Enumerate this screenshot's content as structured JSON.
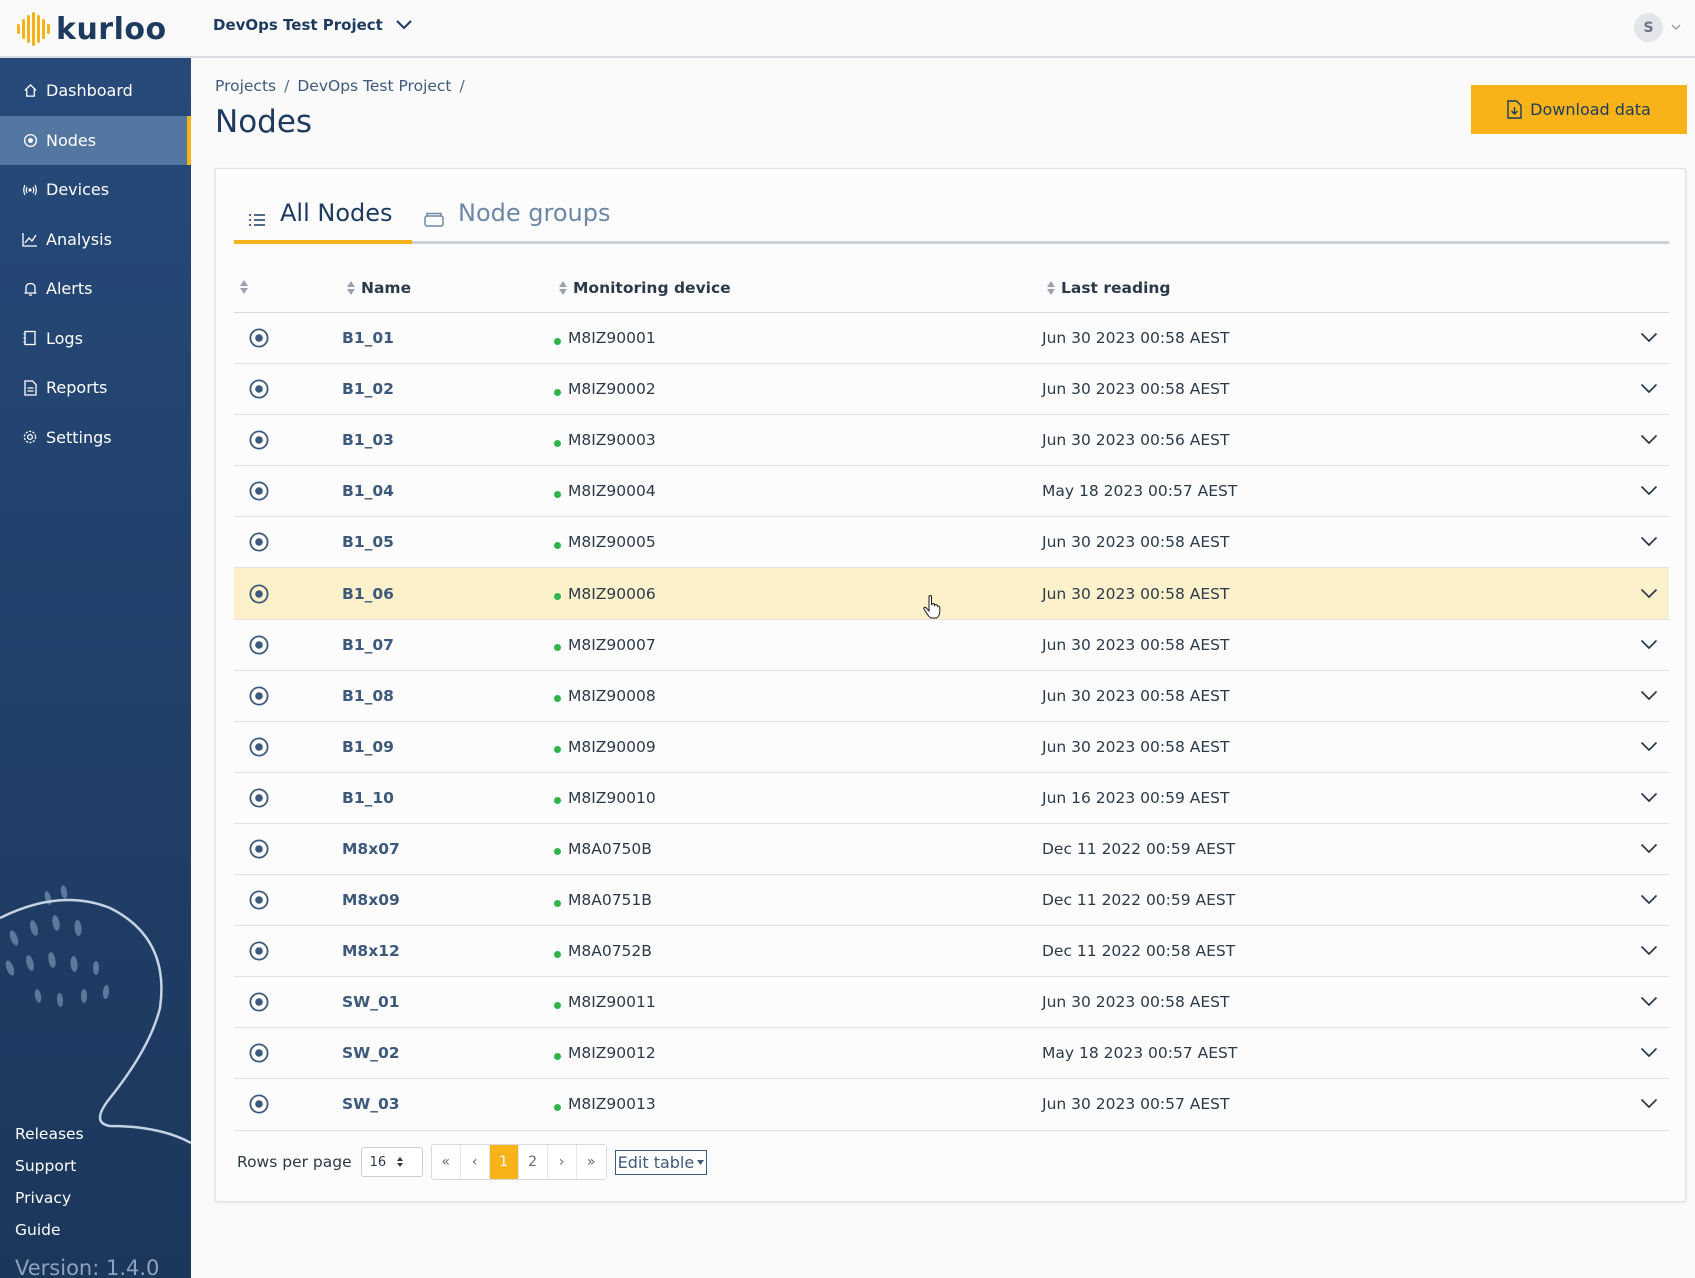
{
  "brand": {
    "name": "kurloo"
  },
  "header": {
    "project": "DevOps Test Project",
    "user_initial": "S"
  },
  "sidebar": {
    "items": [
      {
        "label": "Dashboard",
        "icon": "home-icon"
      },
      {
        "label": "Nodes",
        "icon": "node-icon",
        "active": true
      },
      {
        "label": "Devices",
        "icon": "signal-icon"
      },
      {
        "label": "Analysis",
        "icon": "chart-icon"
      },
      {
        "label": "Alerts",
        "icon": "bell-icon"
      },
      {
        "label": "Logs",
        "icon": "log-icon"
      },
      {
        "label": "Reports",
        "icon": "report-icon"
      },
      {
        "label": "Settings",
        "icon": "gear-icon"
      }
    ],
    "footer_links": [
      "Releases",
      "Support",
      "Privacy",
      "Guide"
    ],
    "version": "Version: 1.4.0"
  },
  "breadcrumb": [
    "Projects",
    "DevOps Test Project"
  ],
  "page": {
    "title": "Nodes",
    "download_label": "Download data"
  },
  "tabs": [
    {
      "label": "All Nodes",
      "icon": "list-icon",
      "active": true
    },
    {
      "label": "Node groups",
      "icon": "folder-icon",
      "active": false
    }
  ],
  "table": {
    "columns": [
      "Name",
      "Monitoring device",
      "Last reading"
    ],
    "rows": [
      {
        "name": "B1_01",
        "device": "M8IZ90001",
        "reading": "Jun 30 2023 00:58 AEST"
      },
      {
        "name": "B1_02",
        "device": "M8IZ90002",
        "reading": "Jun 30 2023 00:58 AEST"
      },
      {
        "name": "B1_03",
        "device": "M8IZ90003",
        "reading": "Jun 30 2023 00:56 AEST"
      },
      {
        "name": "B1_04",
        "device": "M8IZ90004",
        "reading": "May 18 2023 00:57 AEST"
      },
      {
        "name": "B1_05",
        "device": "M8IZ90005",
        "reading": "Jun 30 2023 00:58 AEST"
      },
      {
        "name": "B1_06",
        "device": "M8IZ90006",
        "reading": "Jun 30 2023 00:58 AEST",
        "highlighted": true
      },
      {
        "name": "B1_07",
        "device": "M8IZ90007",
        "reading": "Jun 30 2023 00:58 AEST"
      },
      {
        "name": "B1_08",
        "device": "M8IZ90008",
        "reading": "Jun 30 2023 00:58 AEST"
      },
      {
        "name": "B1_09",
        "device": "M8IZ90009",
        "reading": "Jun 30 2023 00:58 AEST"
      },
      {
        "name": "B1_10",
        "device": "M8IZ90010",
        "reading": "Jun 16 2023 00:59 AEST"
      },
      {
        "name": "M8x07",
        "device": "M8A0750B",
        "reading": "Dec 11 2022 00:59 AEST"
      },
      {
        "name": "M8x09",
        "device": "M8A0751B",
        "reading": "Dec 11 2022 00:59 AEST"
      },
      {
        "name": "M8x12",
        "device": "M8A0752B",
        "reading": "Dec 11 2022 00:58 AEST"
      },
      {
        "name": "SW_01",
        "device": "M8IZ90011",
        "reading": "Jun 30 2023 00:58 AEST"
      },
      {
        "name": "SW_02",
        "device": "M8IZ90012",
        "reading": "May 18 2023 00:57 AEST"
      },
      {
        "name": "SW_03",
        "device": "M8IZ90013",
        "reading": "Jun 30 2023 00:57 AEST"
      }
    ]
  },
  "pagination": {
    "rows_per_page_label": "Rows per page",
    "rows_per_page": "16",
    "first": "«",
    "prev": "‹",
    "pages": [
      "1",
      "2"
    ],
    "current": "1",
    "next": "›",
    "last": "»",
    "edit_table_label": "Edit table"
  },
  "colors": {
    "accent": "#f7b317",
    "sidebar": "#22426d",
    "status_ok": "#2fb34a",
    "highlight": "#fdf1cb"
  }
}
